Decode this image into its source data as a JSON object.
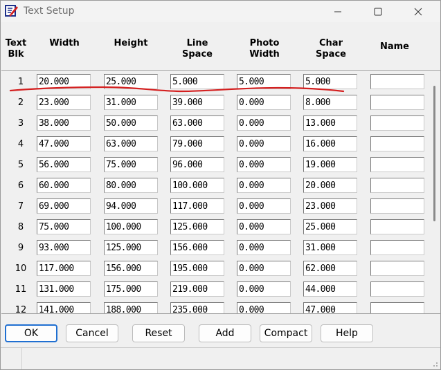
{
  "window": {
    "title": "Text Setup"
  },
  "columns": {
    "text_blk": [
      "Text",
      "Blk"
    ],
    "width": "Width",
    "height": "Height",
    "line_space": [
      "Line",
      "Space"
    ],
    "photo_width": [
      "Photo",
      "Width"
    ],
    "char_space": [
      "Char",
      "Space"
    ],
    "name": "Name"
  },
  "rows": [
    {
      "n": "1",
      "width": "20.000",
      "height": "25.000",
      "line_space": "5.000",
      "photo_width": "5.000",
      "char_space": "5.000",
      "name": ""
    },
    {
      "n": "2",
      "width": "23.000",
      "height": "31.000",
      "line_space": "39.000",
      "photo_width": "0.000",
      "char_space": "8.000",
      "name": ""
    },
    {
      "n": "3",
      "width": "38.000",
      "height": "50.000",
      "line_space": "63.000",
      "photo_width": "0.000",
      "char_space": "13.000",
      "name": ""
    },
    {
      "n": "4",
      "width": "47.000",
      "height": "63.000",
      "line_space": "79.000",
      "photo_width": "0.000",
      "char_space": "16.000",
      "name": ""
    },
    {
      "n": "5",
      "width": "56.000",
      "height": "75.000",
      "line_space": "96.000",
      "photo_width": "0.000",
      "char_space": "19.000",
      "name": ""
    },
    {
      "n": "6",
      "width": "60.000",
      "height": "80.000",
      "line_space": "100.000",
      "photo_width": "0.000",
      "char_space": "20.000",
      "name": ""
    },
    {
      "n": "7",
      "width": "69.000",
      "height": "94.000",
      "line_space": "117.000",
      "photo_width": "0.000",
      "char_space": "23.000",
      "name": ""
    },
    {
      "n": "8",
      "width": "75.000",
      "height": "100.000",
      "line_space": "125.000",
      "photo_width": "0.000",
      "char_space": "25.000",
      "name": ""
    },
    {
      "n": "9",
      "width": "93.000",
      "height": "125.000",
      "line_space": "156.000",
      "photo_width": "0.000",
      "char_space": "31.000",
      "name": ""
    },
    {
      "n": "10",
      "width": "117.000",
      "height": "156.000",
      "line_space": "195.000",
      "photo_width": "0.000",
      "char_space": "62.000",
      "name": ""
    },
    {
      "n": "11",
      "width": "131.000",
      "height": "175.000",
      "line_space": "219.000",
      "photo_width": "0.000",
      "char_space": "44.000",
      "name": ""
    },
    {
      "n": "12",
      "width": "141.000",
      "height": "188.000",
      "line_space": "235.000",
      "photo_width": "0.000",
      "char_space": "47.000",
      "name": ""
    }
  ],
  "buttons": {
    "ok": "OK",
    "cancel": "Cancel",
    "reset": "Reset",
    "add": "Add",
    "compact": "Compact",
    "help": "Help"
  },
  "icons": {
    "app": "text-setup-app-icon",
    "minimize": "minimize-icon",
    "maximize": "maximize-icon",
    "close": "close-icon"
  },
  "colors": {
    "annotation_underline": "#d42020",
    "default_button_border": "#1f6fd1"
  }
}
